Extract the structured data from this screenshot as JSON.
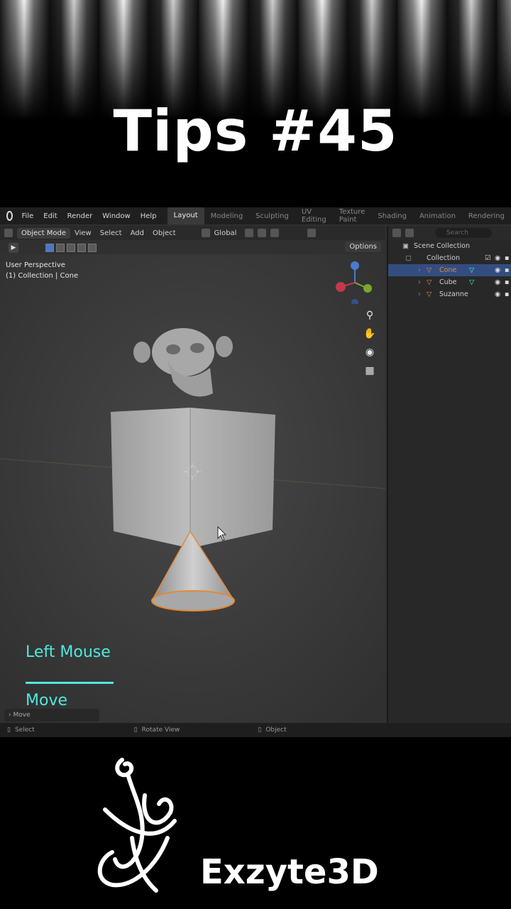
{
  "banner": {
    "title": "Tips #45"
  },
  "menu": [
    "File",
    "Edit",
    "Render",
    "Window",
    "Help"
  ],
  "workspaces": [
    "Layout",
    "Modeling",
    "Sculpting",
    "UV Editing",
    "Texture Paint",
    "Shading",
    "Animation",
    "Rendering"
  ],
  "active_workspace": "Layout",
  "header": {
    "mode": "Object Mode",
    "items": [
      "View",
      "Select",
      "Add",
      "Object"
    ],
    "orientation": "Global",
    "options": "Options"
  },
  "viewport": {
    "perspective": "User Perspective",
    "context": "(1) Collection | Cone",
    "hint_key": "Left Mouse",
    "hint_action": "Move",
    "operator_panel": "Move"
  },
  "outliner": {
    "search_placeholder": "Search",
    "rows": [
      {
        "label": "Scene Collection"
      },
      {
        "label": "Collection"
      },
      {
        "label": "Cone"
      },
      {
        "label": "Cube"
      },
      {
        "label": "Suzanne"
      }
    ],
    "selected": "Cone"
  },
  "status": {
    "select": "Select",
    "rotate": "Rotate View",
    "object": "Object"
  },
  "brand": {
    "name": "Exzyte3D"
  },
  "colors": {
    "hint": "#4fe8e0",
    "selection": "#e08a3a",
    "outliner_selected": "#334d80",
    "ui_dark": "#1f1f1f"
  },
  "icons": [
    "blender-logo-icon",
    "play-icon",
    "zoom-icon",
    "hand-icon",
    "camera-icon",
    "grid-icon",
    "eye-icon",
    "filter-icon",
    "search-icon",
    "mouse-icon"
  ]
}
